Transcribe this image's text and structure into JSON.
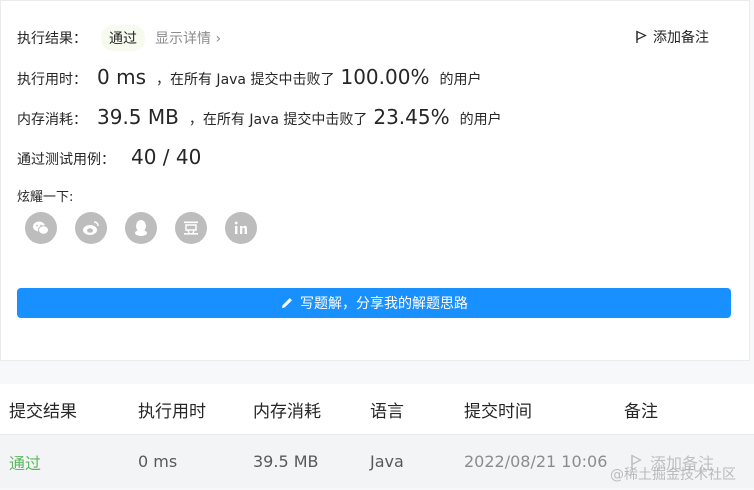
{
  "result": {
    "label": "执行结果：",
    "status": "通过",
    "details_link": "显示详情 ›",
    "add_note": "添加备注"
  },
  "runtime": {
    "label": "执行用时：",
    "value": "0 ms",
    "text": "，在所有 Java 提交中击败了",
    "percent": "100.00%",
    "suffix": "的用户"
  },
  "memory": {
    "label": "内存消耗：",
    "value": "39.5 MB",
    "text": "，在所有 Java 提交中击败了",
    "percent": "23.45%",
    "suffix": "的用户"
  },
  "tests": {
    "label": "通过测试用例：",
    "value": "40 / 40"
  },
  "share": {
    "label": "炫耀一下:",
    "icons": [
      "wechat-icon",
      "weibo-icon",
      "qq-icon",
      "douban-icon",
      "linkedin-icon"
    ]
  },
  "write_button": "写题解，分享我的解题思路",
  "table": {
    "headers": [
      "提交结果",
      "执行用时",
      "内存消耗",
      "语言",
      "提交时间",
      "备注"
    ],
    "rows": [
      {
        "status": "通过",
        "runtime": "0 ms",
        "memory": "39.5 MB",
        "language": "Java",
        "time": "2022/08/21 10:06",
        "note": "添加备注"
      }
    ]
  },
  "watermark": "@稀土掘金技术社区",
  "colors": {
    "accent": "#1890ff",
    "pass": "#5cb85c",
    "share_icon": "#bdbdbd"
  }
}
